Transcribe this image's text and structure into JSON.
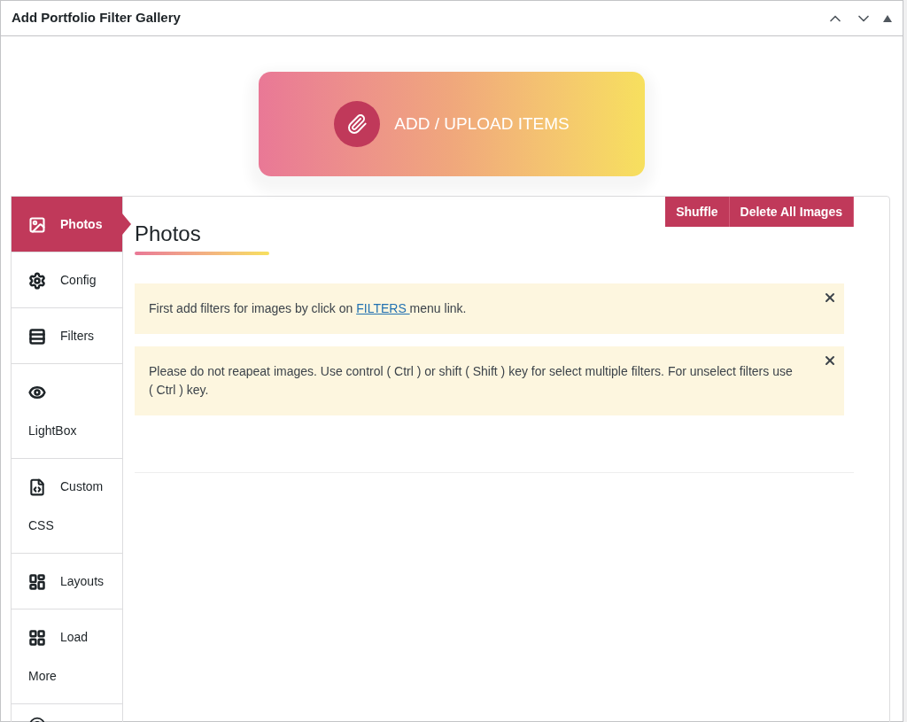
{
  "window": {
    "title": "Add Portfolio Filter Gallery"
  },
  "upload_button": {
    "label": "ADD / UPLOAD ITEMS"
  },
  "sidebar": {
    "items": [
      {
        "label": "Photos",
        "selected": true
      },
      {
        "label": "Config",
        "selected": false
      },
      {
        "label": "Filters",
        "selected": false
      },
      {
        "label": "LightBox",
        "selected": false
      },
      {
        "label": "Custom CSS",
        "selected": false
      },
      {
        "label": "Layouts",
        "selected": false
      },
      {
        "label": "Load More",
        "selected": false
      }
    ]
  },
  "content": {
    "heading": "Photos",
    "buttons": [
      "Shuffle",
      "Delete All Images"
    ],
    "notices": [
      {
        "before": "First add filters for images by click on ",
        "link": "FILTERS ",
        "after": "menu link."
      },
      {
        "before": "Please do not reapeat images. Use control ( Ctrl ) or shift ( Shift ) key for select multiple filters. For unselect filters use ( Ctrl ) key."
      }
    ]
  }
}
